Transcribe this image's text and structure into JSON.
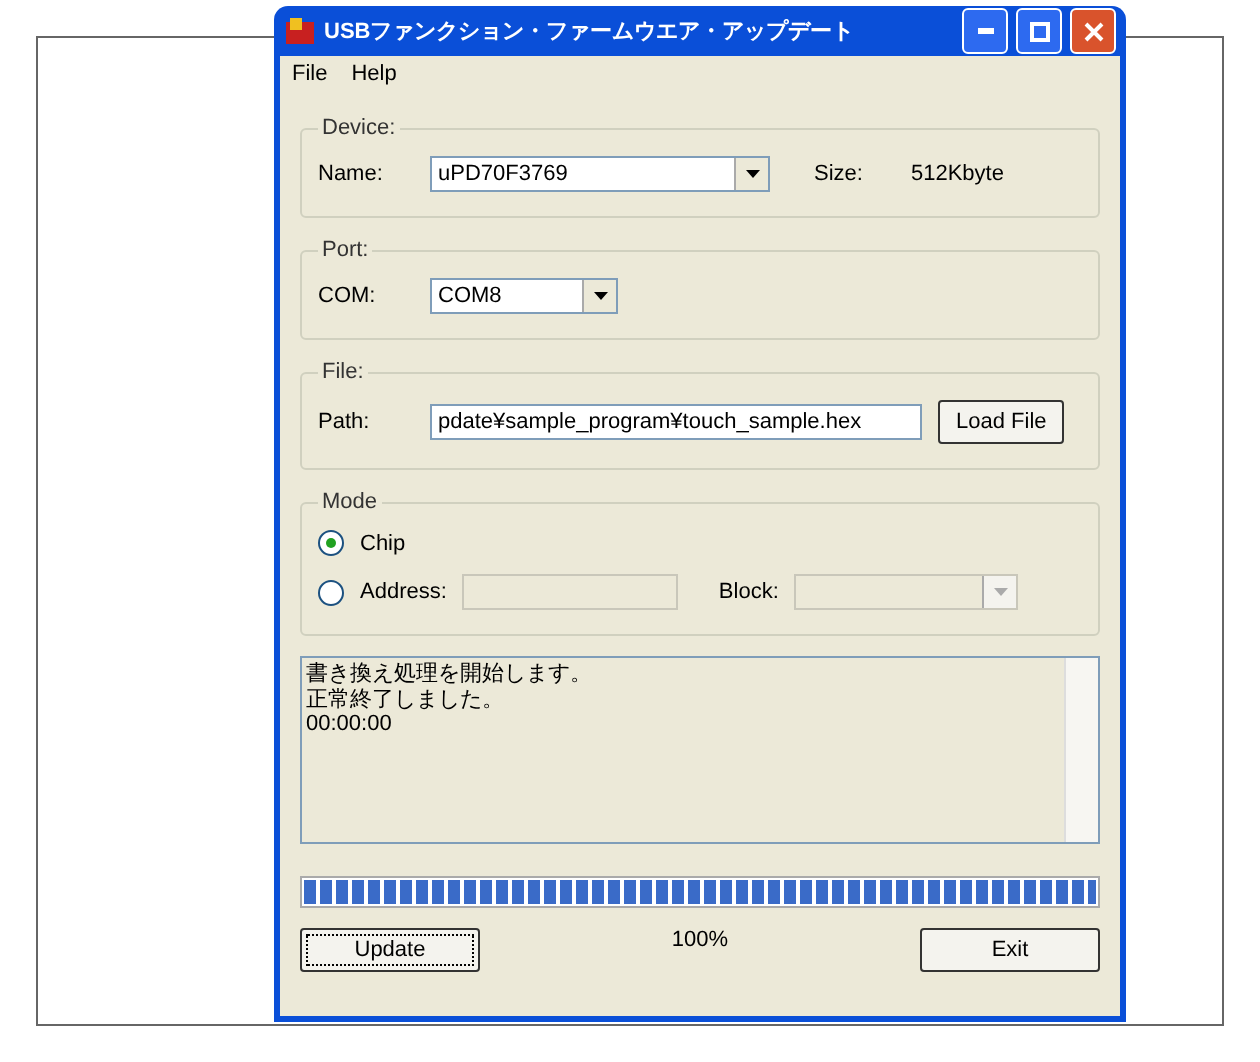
{
  "window": {
    "title": "USBファンクション・ファームウエア・アップデート"
  },
  "menu": [
    {
      "label": "File"
    },
    {
      "label": "Help"
    }
  ],
  "device": {
    "legend": "Device:",
    "name_label": "Name:",
    "name_value": "uPD70F3769",
    "size_label": "Size:",
    "size_value": "512Kbyte"
  },
  "port": {
    "legend": "Port:",
    "com_label": "COM:",
    "com_value": "COM8"
  },
  "file": {
    "legend": "File:",
    "path_label": "Path:",
    "path_value": "pdate¥sample_program¥touch_sample.hex",
    "load_button": "Load File"
  },
  "mode": {
    "legend": "Mode",
    "options": [
      {
        "label": "Chip",
        "selected": true
      },
      {
        "label": "Address:",
        "selected": false
      }
    ],
    "block_label": "Block:",
    "address_disabled": true,
    "block_disabled": true
  },
  "log": [
    "書き換え処理を開始します。",
    "正常終了しました。",
    "00:00:00"
  ],
  "progress": {
    "level": 1,
    "reading": "100%"
  },
  "buttons": [
    {
      "label": "Update",
      "focused": true
    },
    {
      "label": "Exit",
      "focused": false
    }
  ]
}
